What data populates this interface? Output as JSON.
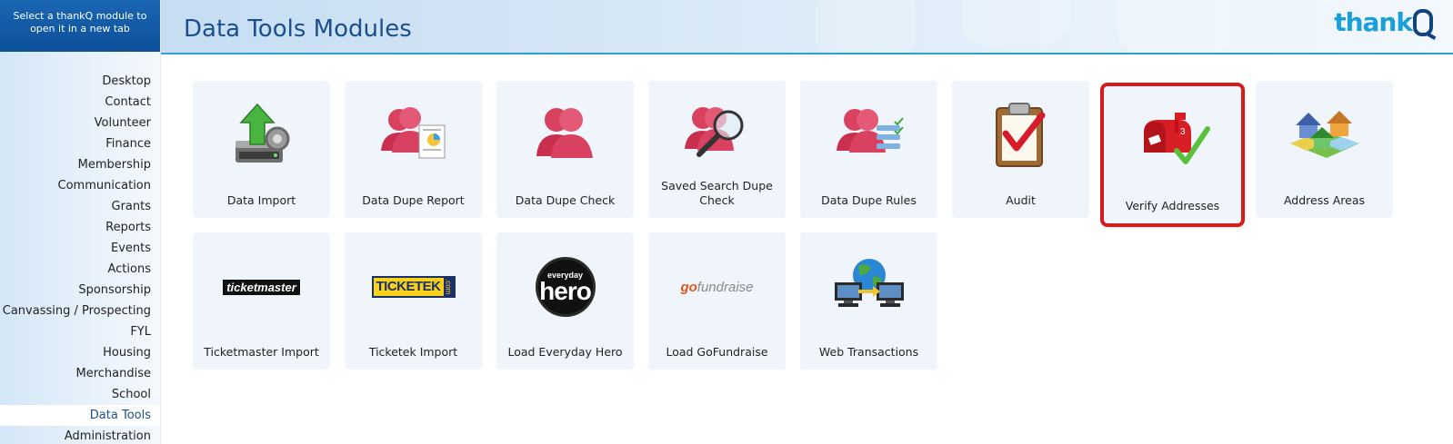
{
  "sidebar": {
    "header_line1": "Select a thankQ module to",
    "header_line2": "open it in a new tab",
    "items": [
      {
        "label": "Desktop"
      },
      {
        "label": "Contact"
      },
      {
        "label": "Volunteer"
      },
      {
        "label": "Finance"
      },
      {
        "label": "Membership"
      },
      {
        "label": "Communication"
      },
      {
        "label": "Grants"
      },
      {
        "label": "Reports"
      },
      {
        "label": "Events"
      },
      {
        "label": "Actions"
      },
      {
        "label": "Sponsorship"
      },
      {
        "label": "Canvassing / Prospecting"
      },
      {
        "label": "FYL"
      },
      {
        "label": "Housing"
      },
      {
        "label": "Merchandise"
      },
      {
        "label": "School"
      },
      {
        "label": "Data Tools"
      },
      {
        "label": "Administration"
      }
    ],
    "active_item": "Data Tools"
  },
  "header": {
    "title": "Data Tools Modules",
    "logo_text": "thank"
  },
  "modules": [
    {
      "label": "Data Import",
      "icon": "data-import-icon"
    },
    {
      "label": "Data Dupe Report",
      "icon": "data-dupe-report-icon"
    },
    {
      "label": "Data Dupe Check",
      "icon": "data-dupe-check-icon"
    },
    {
      "label": "Saved Search Dupe Check",
      "icon": "saved-search-dupe-check-icon"
    },
    {
      "label": "Data Dupe Rules",
      "icon": "data-dupe-rules-icon"
    },
    {
      "label": "Audit",
      "icon": "audit-clipboard-icon"
    },
    {
      "label": "Verify Addresses",
      "icon": "mailbox-check-icon",
      "highlighted": true,
      "mailbox_number": "3"
    },
    {
      "label": "Address Areas",
      "icon": "houses-map-icon"
    },
    {
      "label": "Ticketmaster Import",
      "icon": "ticketmaster-logo-icon",
      "logo_text": "ticketmaster"
    },
    {
      "label": "Ticketek Import",
      "icon": "ticketek-logo-icon",
      "logo_text": "TICKETEK",
      "logo_suffix": ".com"
    },
    {
      "label": "Load Everyday Hero",
      "icon": "everyday-hero-logo-icon",
      "logo_top": "everyday",
      "logo_main": "hero"
    },
    {
      "label": "Load GoFundraise",
      "icon": "gofundraise-logo-icon",
      "logo_text_a": "go",
      "logo_text_b": "fundraise"
    },
    {
      "label": "Web Transactions",
      "icon": "web-transactions-icon"
    }
  ],
  "colors": {
    "accent_blue": "#1a66b3",
    "title_blue": "#1a4f8f",
    "highlight_red": "#d51c1c",
    "logo_cyan": "#1aa0d8",
    "logo_navy": "#13437f"
  }
}
